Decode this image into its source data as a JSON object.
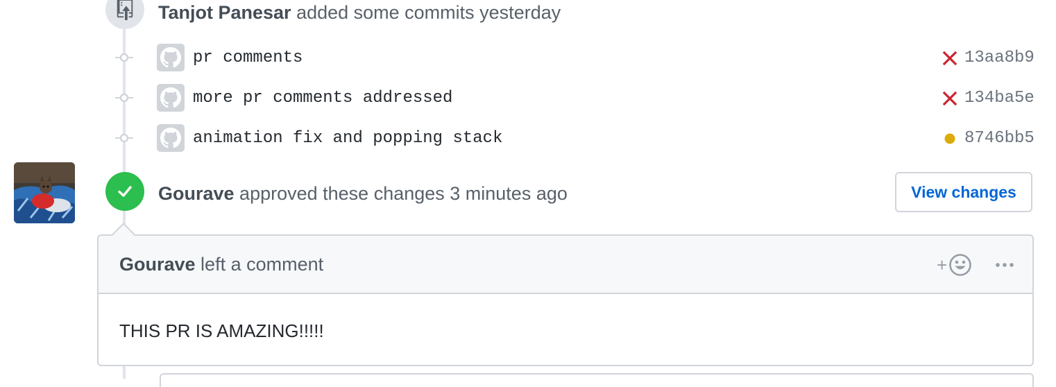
{
  "push_event": {
    "actor": "Tanjot Panesar",
    "action_text": " added some commits yesterday",
    "icon": "repo-push-icon",
    "commits": [
      {
        "message": "pr comments",
        "sha": "13aa8b9",
        "status": "failure",
        "status_icon": "x-icon"
      },
      {
        "message": "more pr comments addressed",
        "sha": "134ba5e",
        "status": "failure",
        "status_icon": "x-icon"
      },
      {
        "message": "animation fix and popping stack",
        "sha": "8746bb5",
        "status": "pending",
        "status_icon": "dot-icon"
      }
    ]
  },
  "review_event": {
    "actor": "Gourave",
    "action_text": " approved these changes 3 minutes ago",
    "icon": "check-icon",
    "view_changes_label": "View changes"
  },
  "comment": {
    "actor": "Gourave",
    "action_text": " left a comment",
    "body": "THIS PR IS AMAZING!!!!!",
    "reaction_plus": "+",
    "reaction_icon": "smiley-icon",
    "more_icon": "kebab-horizontal-icon"
  },
  "colors": {
    "failure": "#cb2431",
    "pending": "#dbab09",
    "approved": "#2cbe4e",
    "link": "#0366d6",
    "timeline": "#e1e4e8"
  }
}
